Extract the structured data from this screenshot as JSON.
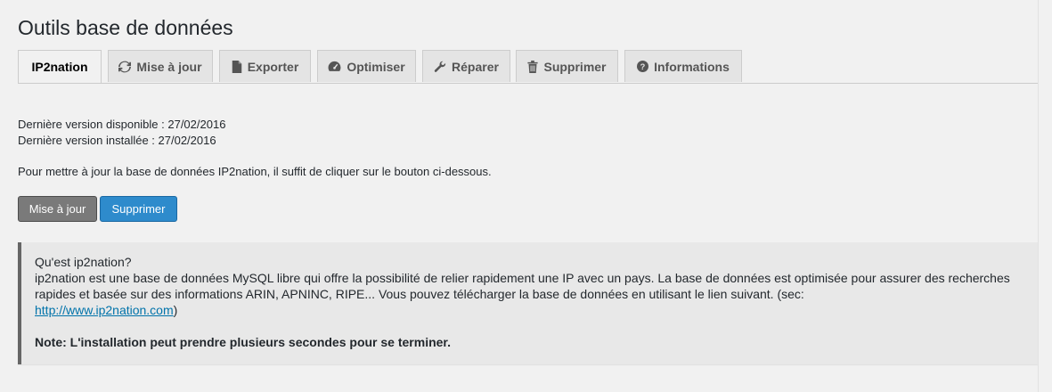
{
  "page": {
    "title": "Outils base de données"
  },
  "tabs": [
    {
      "label": "IP2nation",
      "icon": "none",
      "active": true
    },
    {
      "label": "Mise à jour",
      "icon": "refresh-icon",
      "active": false
    },
    {
      "label": "Exporter",
      "icon": "file-icon",
      "active": false
    },
    {
      "label": "Optimiser",
      "icon": "dashboard-icon",
      "active": false
    },
    {
      "label": "Réparer",
      "icon": "wrench-icon",
      "active": false
    },
    {
      "label": "Supprimer",
      "icon": "trash-icon",
      "active": false
    },
    {
      "label": "Informations",
      "icon": "question-circle-icon",
      "active": false
    }
  ],
  "info": {
    "latest_available": "Dernière version disponible : 27/02/2016",
    "latest_installed": "Dernière version installée : 27/02/2016",
    "instructions": "Pour mettre à jour la base de données IP2nation, il suffit de cliquer sur le bouton ci-dessous."
  },
  "buttons": {
    "update_label": "Mise à jour",
    "delete_label": "Supprimer"
  },
  "notice": {
    "heading": "Qu'est ip2nation?",
    "body": "ip2nation est une base de données MySQL libre qui offre la possibilité de relier rapidement une IP avec un pays. La base de données est optimisée pour assurer des recherches rapides et basée sur des informations ARIN, APNINC, RIPE... Vous pouvez télécharger la base de données en utilisant le lien suivant. (sec:",
    "link_text": "http://www.ip2nation.com",
    "after_link": ")",
    "note": "Note: L'installation peut prendre plusieurs secondes pour se terminer."
  },
  "colors": {
    "background": "#f1f1f1",
    "primary_button": "#2e8bcc",
    "secondary_button": "#7a7a7a",
    "notice_border": "#666666",
    "link": "#0073aa"
  }
}
